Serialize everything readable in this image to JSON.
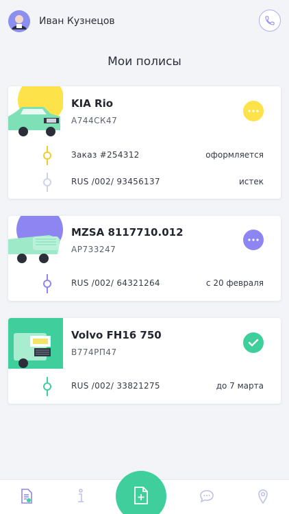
{
  "user": {
    "name": "Иван Кузнецов"
  },
  "page": {
    "title": "Мои полисы"
  },
  "colors": {
    "yellow": "#fde24a",
    "purple": "#8d86f2",
    "green": "#3fcf9c",
    "accent": "#a9aef5"
  },
  "policies": [
    {
      "name": "KIA Rio",
      "plate": "А744СК47",
      "action_icon": "more-dots-icon",
      "rows": [
        {
          "label": "Заказ #254312",
          "status": "оформляется"
        },
        {
          "label": "RUS /002/ 93456137",
          "status": "истек"
        }
      ]
    },
    {
      "name": "MZSA 8117710.012",
      "plate": "АР733247",
      "action_icon": "more-dots-icon",
      "rows": [
        {
          "label": "RUS /002/ 64321264",
          "status": "с 20 февраля"
        }
      ]
    },
    {
      "name": "Volvo FH16 750",
      "plate": "В774РП47",
      "action_icon": "check-icon",
      "rows": [
        {
          "label": "RUS /002/ 33821275",
          "status": "до 7 марта"
        }
      ]
    }
  ],
  "nav": [
    {
      "icon": "policies-document-icon"
    },
    {
      "icon": "info-icon"
    },
    {
      "icon": "add-document-icon"
    },
    {
      "icon": "chat-icon"
    },
    {
      "icon": "location-pin-icon"
    }
  ]
}
